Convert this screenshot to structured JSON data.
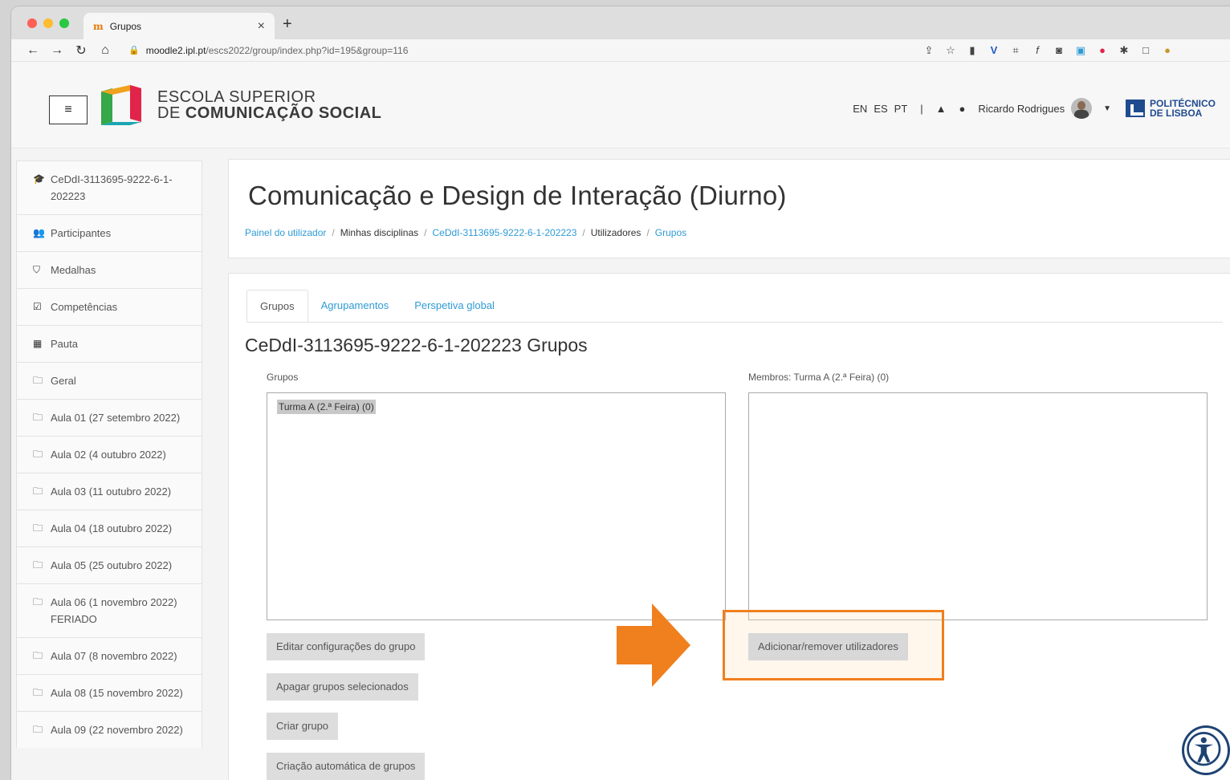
{
  "browser": {
    "tab_title": "Grupos",
    "tab_favicon": "moodle-m",
    "url_domain": "moodle2.ipl.pt",
    "url_path": "/escs2022/group/index.php?id=195&group=116"
  },
  "header": {
    "logo_line1": "ESCOLA SUPERIOR",
    "logo_line2_prefix": "DE ",
    "logo_line2_bold": "COMUNICAÇÃO SOCIAL",
    "languages": [
      "EN",
      "ES",
      "PT"
    ],
    "separator": "|",
    "user_name": "Ricardo Rodrigues",
    "partner_line1": "POLITÉCNICO",
    "partner_line2": "DE LISBOA"
  },
  "sidebar": {
    "items": [
      {
        "icon": "graduation-cap-icon",
        "label": "CeDdI-3113695-9222-6-1-202223"
      },
      {
        "icon": "users-icon",
        "label": "Participantes"
      },
      {
        "icon": "shield-icon",
        "label": "Medalhas"
      },
      {
        "icon": "check-square-icon",
        "label": "Competências"
      },
      {
        "icon": "table-icon",
        "label": "Pauta"
      },
      {
        "icon": "folder-icon",
        "label": "Geral"
      },
      {
        "icon": "folder-icon",
        "label": "Aula 01 (27 setembro 2022)"
      },
      {
        "icon": "folder-icon",
        "label": "Aula 02 (4 outubro 2022)"
      },
      {
        "icon": "folder-icon",
        "label": "Aula 03 (11 outubro 2022)"
      },
      {
        "icon": "folder-icon",
        "label": "Aula 04 (18 outubro 2022)"
      },
      {
        "icon": "folder-icon",
        "label": "Aula 05 (25 outubro 2022)"
      },
      {
        "icon": "folder-icon",
        "label": "Aula 06 (1 novembro 2022) FERIADO"
      },
      {
        "icon": "folder-icon",
        "label": "Aula 07 (8 novembro 2022)"
      },
      {
        "icon": "folder-icon",
        "label": "Aula 08 (15 novembro 2022)"
      },
      {
        "icon": "folder-icon",
        "label": "Aula 09 (22 novembro 2022)"
      }
    ]
  },
  "course": {
    "title": "Comunicação e Design de Interação (Diurno)",
    "breadcrumb": [
      {
        "label": "Painel do utilizador",
        "link": true
      },
      {
        "label": "Minhas disciplinas",
        "link": false
      },
      {
        "label": "CeDdI-3113695-9222-6-1-202223",
        "link": true
      },
      {
        "label": "Utilizadores",
        "link": false
      },
      {
        "label": "Grupos",
        "link": true
      }
    ]
  },
  "groups_page": {
    "tabs": [
      {
        "label": "Grupos",
        "active": true
      },
      {
        "label": "Agrupamentos",
        "active": false
      },
      {
        "label": "Perspetiva global",
        "active": false
      }
    ],
    "heading": "CeDdI-3113695-9222-6-1-202223 Grupos",
    "groups_label": "Grupos",
    "members_label": "Membros: Turma A (2.ª Feira) (0)",
    "groups_options": [
      "Turma A (2.ª Feira) (0)"
    ],
    "buttons": {
      "edit_group": "Editar configurações do grupo",
      "delete_groups": "Apagar grupos selecionados",
      "create_group": "Criar grupo",
      "auto_create": "Criação automática de grupos",
      "add_remove_users": "Adicionar/remover utilizadores"
    }
  },
  "colors": {
    "link": "#2f9bd6",
    "annotation": "#f07f1d",
    "logo_orange": "#f0a21e",
    "logo_green": "#35a849",
    "logo_teal": "#1aa5b4"
  }
}
